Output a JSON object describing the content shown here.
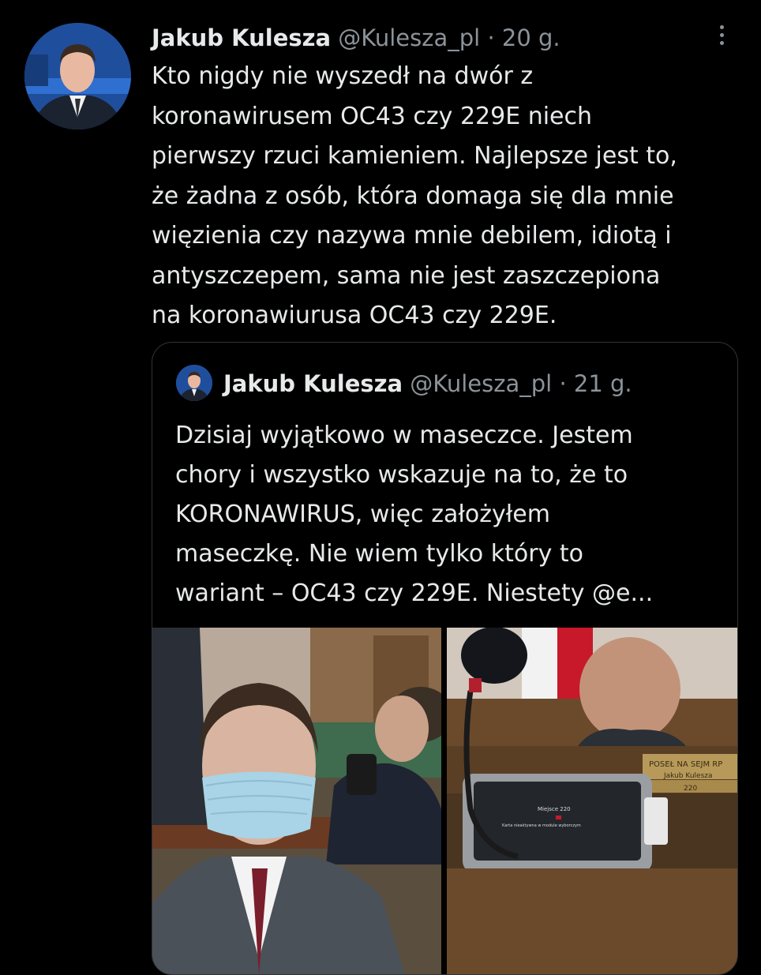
{
  "tweet": {
    "author": {
      "display_name": "Jakub Kulesza",
      "handle": "@Kulesza_pl",
      "separator": "·",
      "time": "20 g."
    },
    "text_lines": [
      "Kto nigdy nie wyszedł na dwór z",
      "koronawirusem OC43 czy 229E niech",
      "pierwszy rzuci kamieniem. Najlepsze jest to,",
      "że żadna z osób, która domaga się dla mnie",
      "więzienia czy nazywa mnie debilem, idiotą i",
      "antyszczepem, sama nie jest zaszczepiona",
      "na koronawiurusa OC43 czy 229E."
    ],
    "more_icon": "more-vertical-icon"
  },
  "quoted_tweet": {
    "author": {
      "display_name": "Jakub Kulesza",
      "handle": "@Kulesza_pl",
      "separator": "·",
      "time": "21 g."
    },
    "text_lines": [
      "Dzisiaj wyjątkowo w maseczce. Jestem",
      "chory i wszystko wskazuje na to, że to",
      "KORONAWIRUS, więc założyłem",
      "maseczkę. Nie wiem tylko który to",
      "wariant – OC43 czy 229E. Niestety @e..."
    ],
    "photos": {
      "right": {
        "nameplate_line1": "POSEŁ NA SEJM RP",
        "nameplate_line2": "Jakub Kulesza",
        "nameplate_number": "220",
        "screen_line1": "Miejsce 220",
        "screen_line2": "Karta nieaktywna w module wyborczym"
      }
    }
  },
  "colors": {
    "background": "#000000",
    "text": "#e7e9ea",
    "secondary": "#8b9399",
    "border": "#2f3336"
  }
}
